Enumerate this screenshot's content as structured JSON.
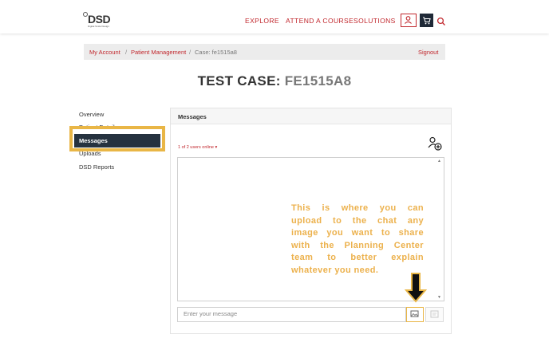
{
  "header": {
    "logo_text": "DSD",
    "logo_sub": "Digital Smile Design",
    "nav": [
      "EXPLORE",
      "ATTEND A COURSE",
      "SOLUTIONS"
    ]
  },
  "breadcrumb": {
    "my_account": "My Account",
    "patient_management": "Patient Management",
    "sep": "/",
    "current": "Case: fe1515a8",
    "signout": "Signout"
  },
  "title": {
    "label": "TEST CASE: ",
    "case_id": "FE1515A8"
  },
  "sidebar": {
    "items": [
      "Overview",
      "Patient Details",
      "Messages",
      "Uploads",
      "DSD Reports"
    ],
    "active": "Messages"
  },
  "panel": {
    "title": "Messages",
    "users_online": "1 of 2 users online ▾",
    "input_placeholder": "Enter your message"
  },
  "callout": {
    "lines": [
      "This is where you can",
      "upload to the chat any",
      "image you want to share",
      "with the Planning Center",
      "team to better explain",
      "whatever you need."
    ]
  },
  "icons": {
    "account": "user-icon",
    "cart": "cart-icon",
    "search": "search-icon",
    "add_user": "add-user-icon",
    "attach": "image-attach-icon",
    "send": "send-icon"
  },
  "colors": {
    "brand_red": "#c1272d",
    "sidebar_active": "#26323f",
    "highlight": "#e9b646",
    "callout_text": "#ecb14c"
  }
}
